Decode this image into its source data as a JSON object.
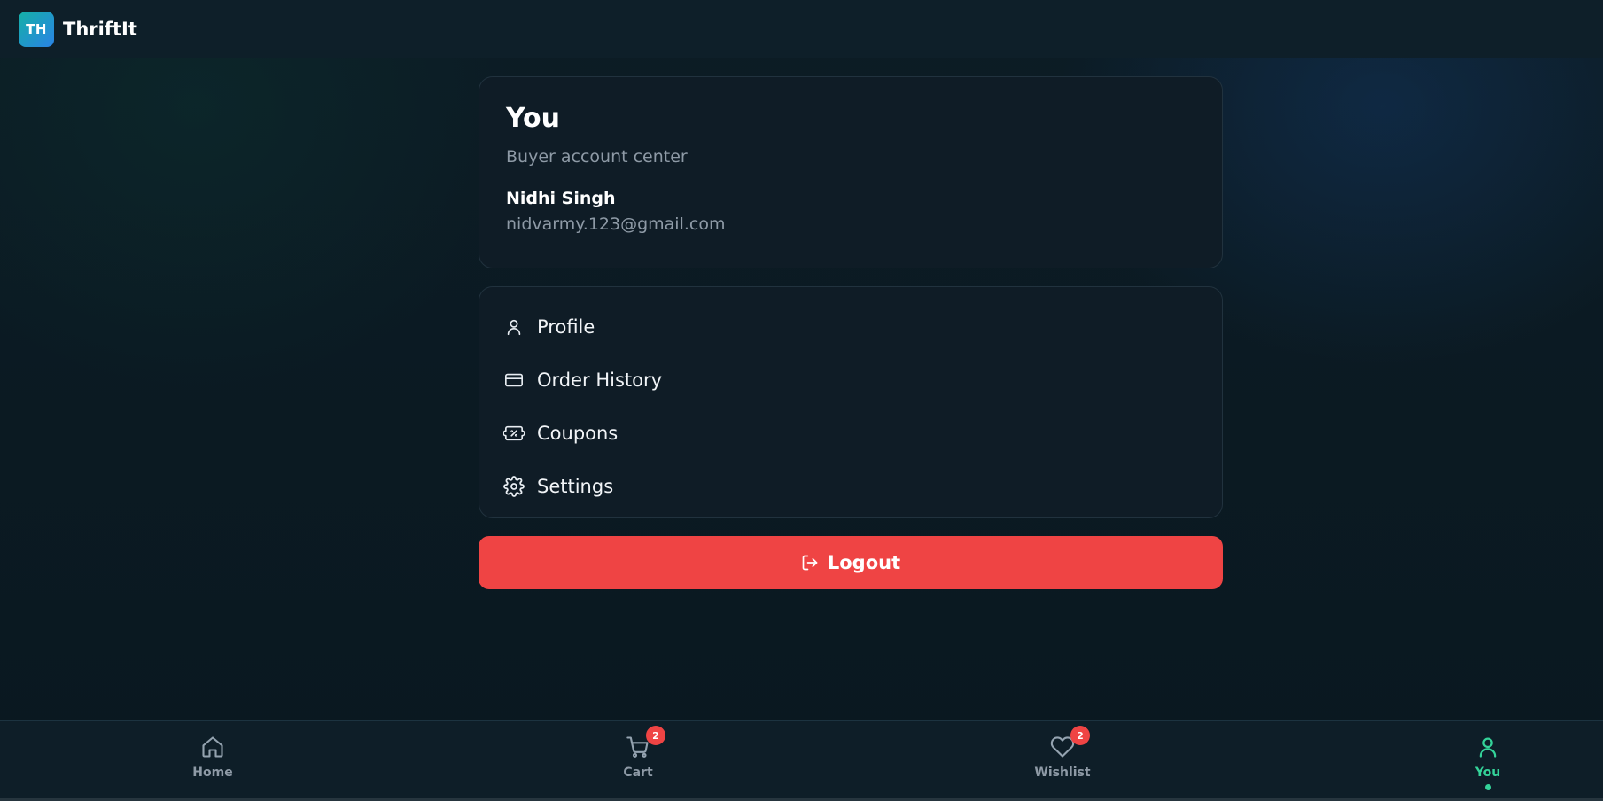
{
  "app": {
    "logo_initials": "TH",
    "brand_name": "ThriftIt"
  },
  "account": {
    "title": "You",
    "subtitle": "Buyer account center",
    "user_name": "Nidhi Singh",
    "user_email": "nidvarmy.123@gmail.com"
  },
  "menu": {
    "items": [
      {
        "label": "Profile",
        "icon": "user-icon"
      },
      {
        "label": "Order History",
        "icon": "credit-card-icon"
      },
      {
        "label": "Coupons",
        "icon": "ticket-percent-icon"
      },
      {
        "label": "Settings",
        "icon": "gear-icon"
      }
    ]
  },
  "logout": {
    "label": "Logout",
    "icon": "logout-icon"
  },
  "bottom_nav": {
    "items": [
      {
        "label": "Home",
        "icon": "home-icon",
        "badge": null,
        "active": false
      },
      {
        "label": "Cart",
        "icon": "cart-icon",
        "badge": "2",
        "active": false
      },
      {
        "label": "Wishlist",
        "icon": "heart-icon",
        "badge": "2",
        "active": false
      },
      {
        "label": "You",
        "icon": "user-icon",
        "badge": null,
        "active": true
      }
    ]
  },
  "colors": {
    "accent": "#34d399",
    "danger": "#ef4444",
    "logo_gradient_start": "#14b0a6",
    "logo_gradient_end": "#2a83e6"
  }
}
